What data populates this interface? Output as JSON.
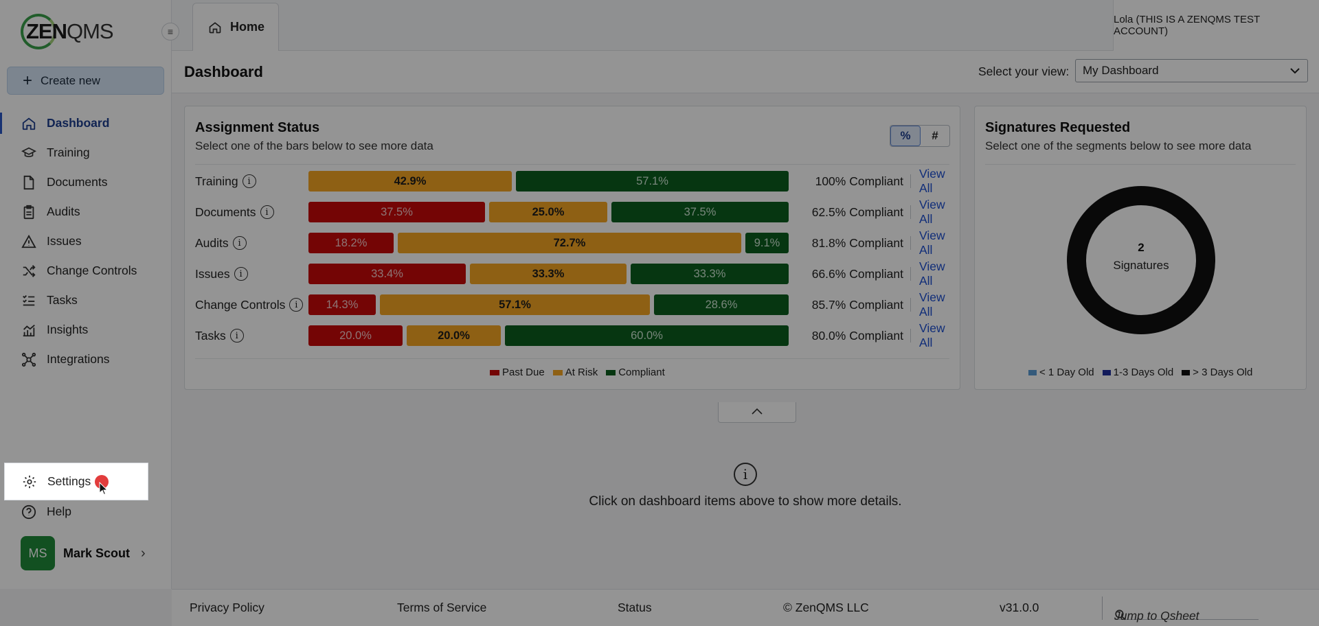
{
  "app": {
    "logo_text_bold": "ZEN",
    "logo_text_light": "QMS"
  },
  "sidebar": {
    "create_label": "Create new",
    "items": [
      {
        "label": "Dashboard",
        "icon": "home-icon",
        "active": true
      },
      {
        "label": "Training",
        "icon": "graduation-cap-icon"
      },
      {
        "label": "Documents",
        "icon": "document-icon"
      },
      {
        "label": "Audits",
        "icon": "clipboard-icon"
      },
      {
        "label": "Issues",
        "icon": "warning-icon"
      },
      {
        "label": "Change Controls",
        "icon": "shuffle-icon"
      },
      {
        "label": "Tasks",
        "icon": "checklist-icon"
      },
      {
        "label": "Insights",
        "icon": "chart-icon"
      },
      {
        "label": "Integrations",
        "icon": "network-icon"
      }
    ],
    "settings_label": "Settings",
    "help_label": "Help",
    "user": {
      "initials": "MS",
      "name": "Mark Scout"
    }
  },
  "header": {
    "tab_label": "Home",
    "account": "Lola (THIS IS A ZENQMS TEST ACCOUNT)"
  },
  "titlebar": {
    "title": "Dashboard",
    "view_label": "Select your view:",
    "view_value": "My Dashboard"
  },
  "assignment": {
    "title": "Assignment Status",
    "subtitle": "Select one of the bars below to see more data",
    "toggle_percent": "%",
    "toggle_count": "#",
    "view_all": "View All",
    "legend": {
      "past_due": "Past Due",
      "at_risk": "At Risk",
      "compliant": "Compliant"
    },
    "colors": {
      "past_due": "#c80a0a",
      "at_risk": "#f5a623",
      "compliant": "#0b5d1e"
    },
    "rows": [
      {
        "label": "Training",
        "past_due": null,
        "at_risk": "42.9%",
        "compliant": "57.1%",
        "summary": "100% Compliant"
      },
      {
        "label": "Documents",
        "past_due": "37.5%",
        "at_risk": "25.0%",
        "compliant": "37.5%",
        "summary": "62.5% Compliant"
      },
      {
        "label": "Audits",
        "past_due": "18.2%",
        "at_risk": "72.7%",
        "compliant": "9.1%",
        "summary": "81.8% Compliant"
      },
      {
        "label": "Issues",
        "past_due": "33.4%",
        "at_risk": "33.3%",
        "compliant": "33.3%",
        "summary": "66.6% Compliant"
      },
      {
        "label": "Change Controls",
        "past_due": "14.3%",
        "at_risk": "57.1%",
        "compliant": "28.6%",
        "summary": "85.7% Compliant"
      },
      {
        "label": "Tasks",
        "past_due": "20.0%",
        "at_risk": "20.0%",
        "compliant": "60.0%",
        "summary": "80.0% Compliant"
      }
    ]
  },
  "signatures": {
    "title": "Signatures Requested",
    "subtitle": "Select one of the segments below to see more data",
    "count": "2",
    "count_label": "Signatures",
    "legend": {
      "lt1": "< 1 Day Old",
      "d13": "1-3 Days Old",
      "gt3": "> 3 Days Old"
    },
    "colors": {
      "lt1": "#5b9bd5",
      "d13": "#1f2f9e",
      "gt3": "#111111"
    }
  },
  "details": {
    "message": "Click on dashboard items above to show more details."
  },
  "footer": {
    "privacy": "Privacy Policy",
    "terms": "Terms of Service",
    "status": "Status",
    "copyright": "© ZenQMS LLC",
    "version": "v31.0.0",
    "qsheet_placeholder": "Jump to Qsheet"
  }
}
